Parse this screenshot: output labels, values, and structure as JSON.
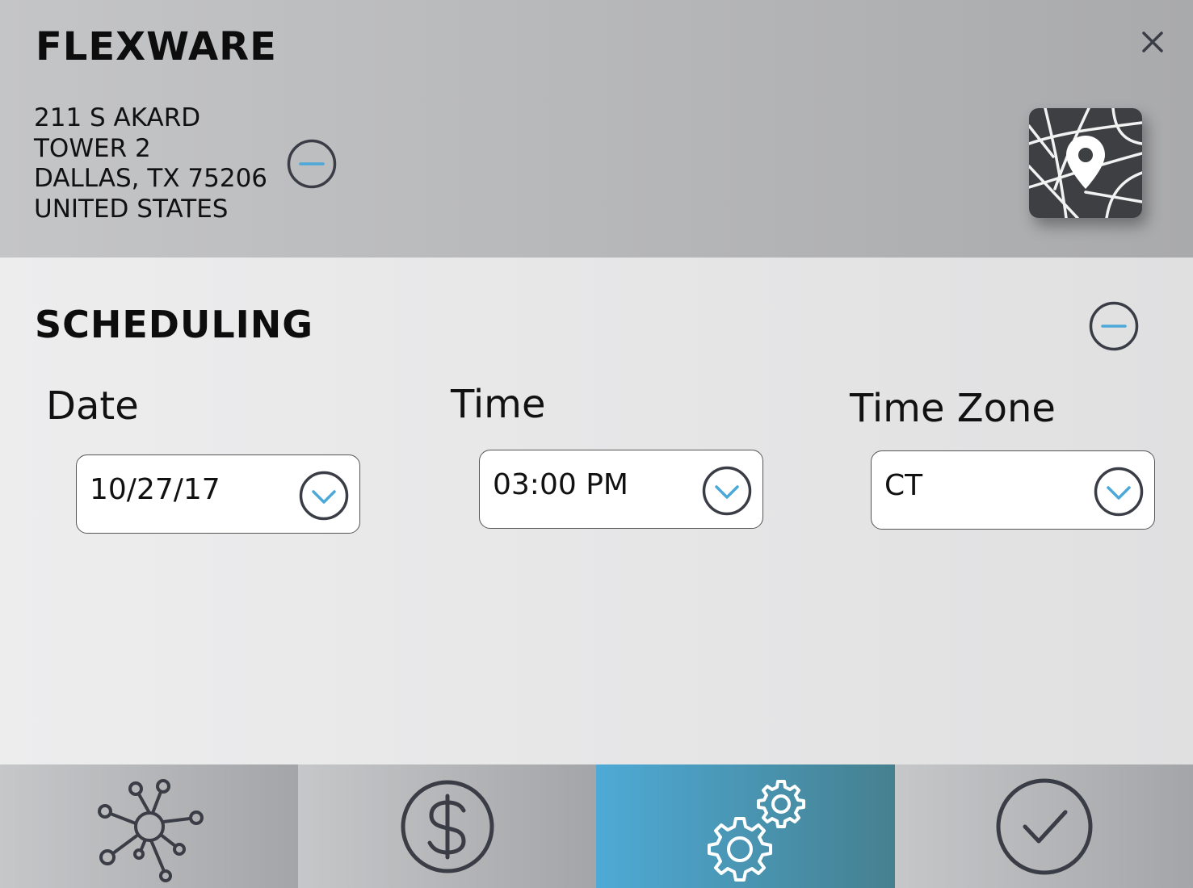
{
  "header": {
    "company": "FLEXWARE",
    "address": [
      "211 S AKARD",
      "TOWER 2",
      "DALLAS, TX 75206",
      "UNITED STATES"
    ],
    "icons": {
      "close": "close-icon",
      "collapse": "minus-circle-icon",
      "map": "map-pin-icon"
    }
  },
  "scheduling": {
    "title": "SCHEDULING",
    "fields": {
      "date": {
        "label": "Date",
        "value": "10/27/17"
      },
      "time": {
        "label": "Time",
        "value": "03:00 PM"
      },
      "timezone": {
        "label": "Time Zone",
        "value": "CT"
      }
    }
  },
  "navbar": {
    "tabs": [
      {
        "icon": "network-hub-icon",
        "active": false
      },
      {
        "icon": "dollar-icon",
        "active": false
      },
      {
        "icon": "gears-icon",
        "active": true
      },
      {
        "icon": "checkmark-icon",
        "active": false
      }
    ]
  },
  "colors": {
    "accent": "#4ba8d8",
    "icon_stroke": "#3a3d45",
    "active_tab_start": "#4eaad6",
    "active_tab_end": "#45808f"
  }
}
